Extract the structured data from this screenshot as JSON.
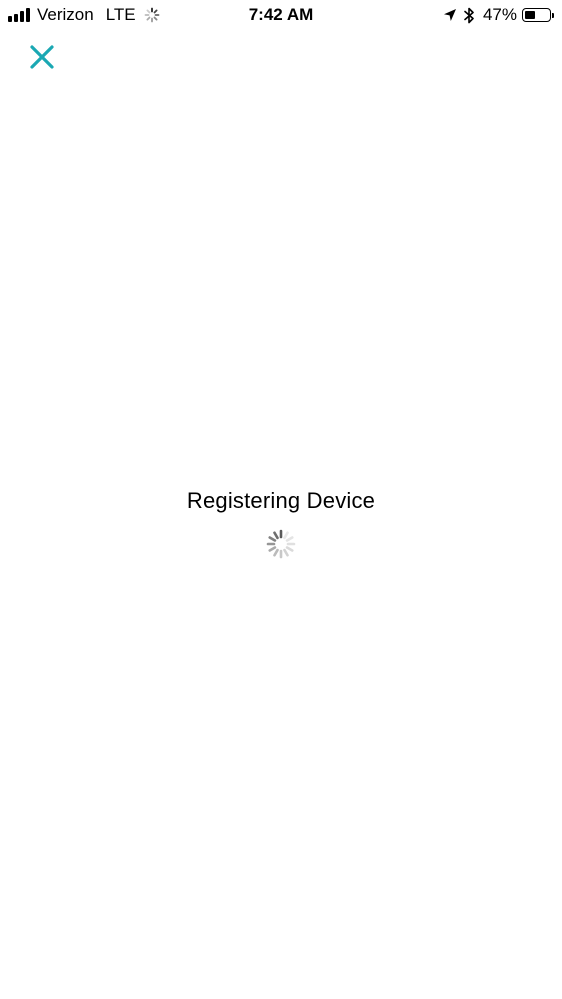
{
  "status_bar": {
    "carrier": "Verizon",
    "network": "LTE",
    "time": "7:42 AM",
    "battery_percent": "47%",
    "battery_level": 0.47,
    "signal_bars": 4,
    "icons": [
      "signal-bars-icon",
      "network-activity-icon",
      "location-arrow-icon",
      "bluetooth-icon",
      "battery-icon"
    ]
  },
  "header": {
    "close_icon": "close-icon",
    "accent_color": "#1aa8b3"
  },
  "main": {
    "loading_text": "Registering Device",
    "spinner_icon": "loading-spinner-icon"
  }
}
